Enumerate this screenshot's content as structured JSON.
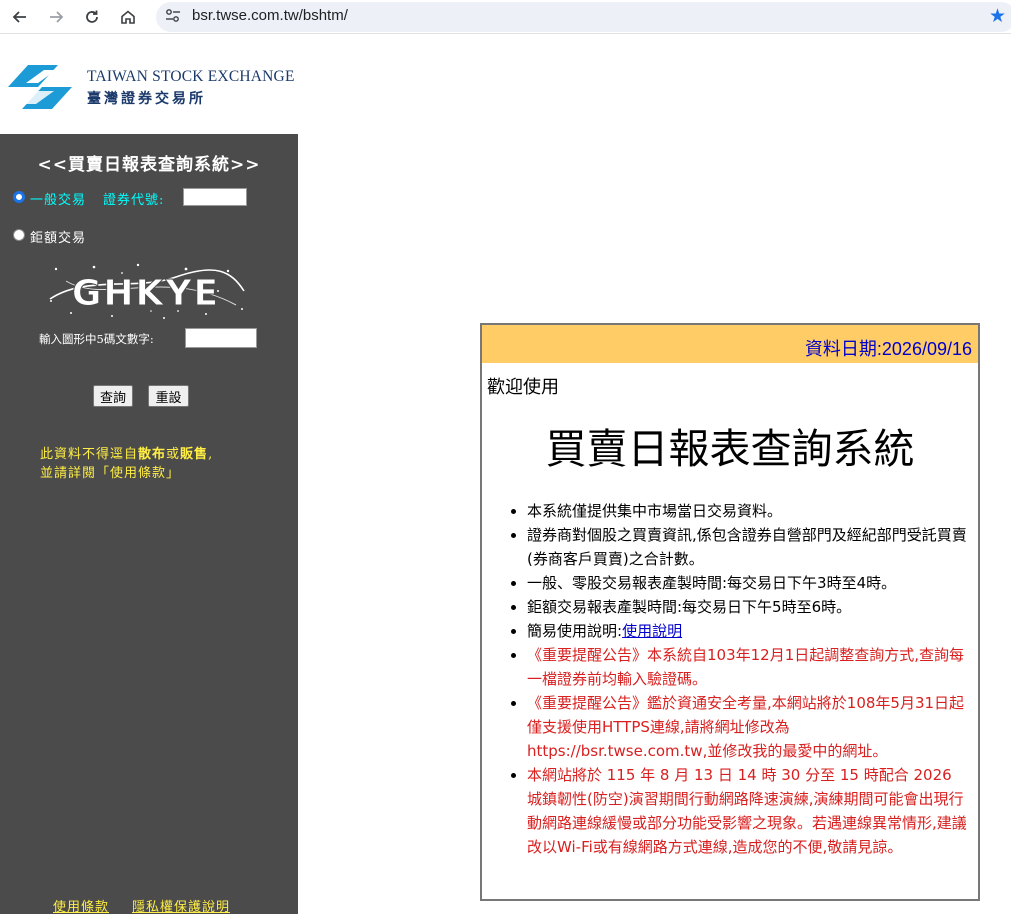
{
  "browser": {
    "url": "bsr.twse.com.tw/bshtm/"
  },
  "logo": {
    "en": "TAIWAN STOCK EXCHANGE",
    "zh": "臺灣證券交易所"
  },
  "sidebar": {
    "title": "<<買賣日報表查詢系統>>",
    "radio_general": "一般交易",
    "stock_code_label": "證券代號:",
    "stock_code_value": "",
    "radio_block": "鉅額交易",
    "captcha_text": "GHKYE",
    "captcha_label": "輸入圖形中5碼文數字:",
    "captcha_value": "",
    "query_button": "查詢",
    "reset_button": "重設",
    "notice_line1_a": "此資料不得逕自",
    "notice_line1_b": "散布",
    "notice_line1_c": "或",
    "notice_line1_d": "販售",
    "notice_line1_e": ",",
    "notice_line2": "並請詳閱「使用條款」",
    "footer_terms": "使用條款",
    "footer_privacy": "隱私權保護說明"
  },
  "panel": {
    "date": "資料日期:2026/09/16",
    "welcome": "歡迎使用",
    "title": "買賣日報表查詢系統",
    "items": [
      "本系統僅提供集中市場當日交易資料。",
      "證券商對個股之買賣資訊,係包含證券自營部門及經紀部門受託買賣(券商客戶買賣)之合計數。",
      "一般、零股交易報表產製時間:每交易日下午3時至4時。",
      "鉅額交易報表產製時間:每交易日下午5時至6時。",
      "簡易使用說明:",
      "《重要提醒公告》本系統自103年12月1日起調整查詢方式,查詢每一檔證券前均輸入驗證碼。",
      "《重要提醒公告》鑑於資通安全考量,本網站將於108年5月31日起僅支援使用HTTPS連線,請將網址修改為https://bsr.twse.com.tw,並修改我的最愛中的網址。",
      "本網站將於 115 年 8 月 13 日 14 時 30 分至 15 時配合 2026 城鎮韌性(防空)演習期間行動網路降速演練,演練期間可能會出現行動網路連線緩慢或部分功能受影響之現象。若遇連線異常情形,建議改以Wi-Fi或有線網路方式連線,造成您的不便,敬請見諒。"
    ],
    "usage_link": "使用說明"
  }
}
